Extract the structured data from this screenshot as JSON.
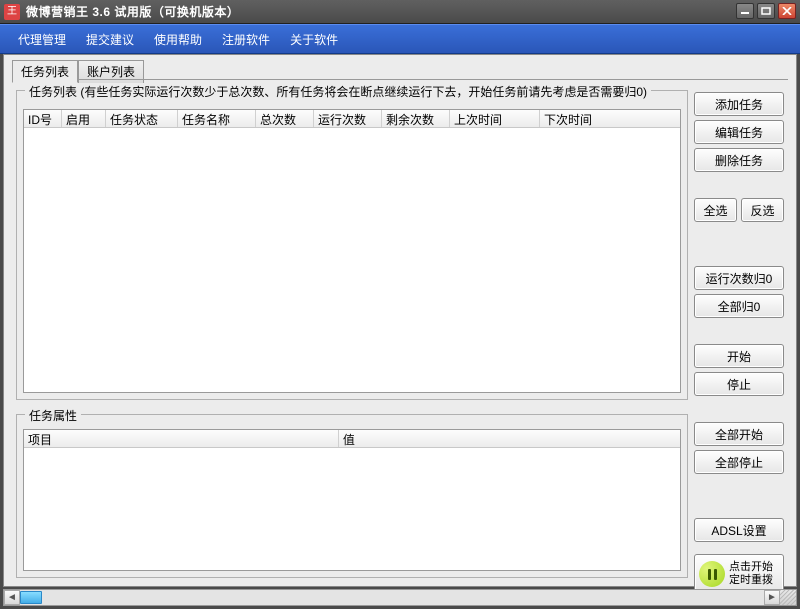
{
  "window": {
    "title": "微博营销王 3.6 试用版（可换机版本）"
  },
  "menu": {
    "items": [
      "代理管理",
      "提交建议",
      "使用帮助",
      "注册软件",
      "关于软件"
    ]
  },
  "tabs": {
    "task_list": "任务列表",
    "account_list": "账户列表"
  },
  "group_tasklist": {
    "label": "任务列表 (有些任务实际运行次数少于总次数、所有任务将会在断点继续运行下去，开始任务前请先考虑是否需要归0)",
    "columns": [
      "ID号",
      "启用",
      "任务状态",
      "任务名称",
      "总次数",
      "运行次数",
      "剩余次数",
      "上次时间",
      "下次时间"
    ]
  },
  "group_taskprops": {
    "label": "任务属性",
    "columns": [
      "项目",
      "值"
    ]
  },
  "buttons": {
    "add_task": "添加任务",
    "edit_task": "编辑任务",
    "delete_task": "删除任务",
    "select_all": "全选",
    "invert_sel": "反选",
    "run_count_zero": "运行次数归0",
    "all_zero": "全部归0",
    "start": "开始",
    "stop": "停止",
    "start_all": "全部开始",
    "stop_all": "全部停止",
    "adsl_settings": "ADSL设置",
    "start_timer_line1": "点击开始",
    "start_timer_line2": "定时重拨"
  }
}
